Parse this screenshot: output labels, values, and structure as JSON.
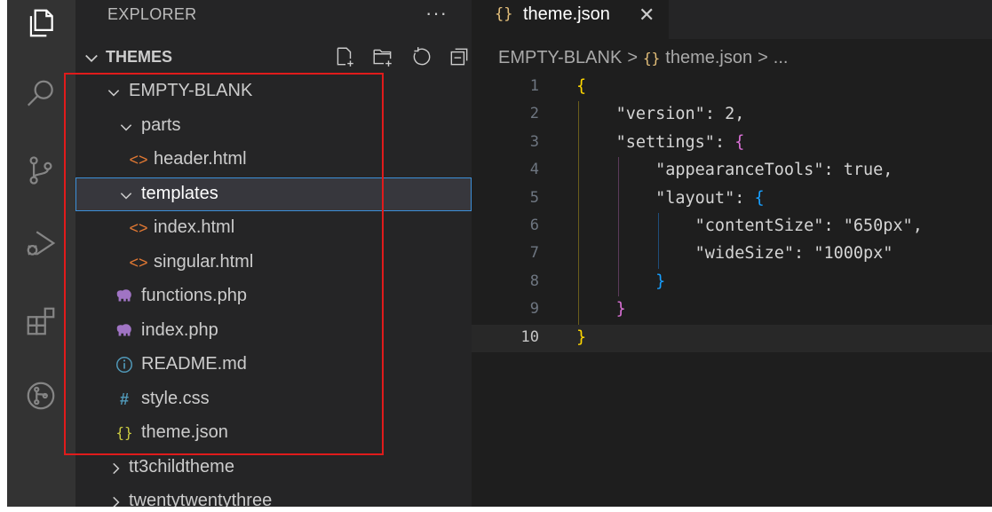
{
  "explorer": {
    "title": "EXPLORER",
    "more_label": "···",
    "section_title": "THEMES",
    "actions": [
      "new-file-icon",
      "new-folder-icon",
      "refresh-icon",
      "collapse-all-icon"
    ]
  },
  "tree": [
    {
      "label": "EMPTY-BLANK",
      "type": "folder",
      "expanded": true,
      "depth": 0
    },
    {
      "label": "parts",
      "type": "folder",
      "expanded": true,
      "depth": 1
    },
    {
      "label": "header.html",
      "type": "html",
      "depth": 2
    },
    {
      "label": "templates",
      "type": "folder",
      "expanded": true,
      "depth": 1,
      "selected": true
    },
    {
      "label": "index.html",
      "type": "html",
      "depth": 2
    },
    {
      "label": "singular.html",
      "type": "html",
      "depth": 2
    },
    {
      "label": "functions.php",
      "type": "php",
      "depth": 1
    },
    {
      "label": "index.php",
      "type": "php",
      "depth": 1
    },
    {
      "label": "README.md",
      "type": "info",
      "depth": 1
    },
    {
      "label": "style.css",
      "type": "css",
      "depth": 1
    },
    {
      "label": "theme.json",
      "type": "json",
      "depth": 1
    },
    {
      "label": "tt3childtheme",
      "type": "folder",
      "expanded": false,
      "depth": 0
    },
    {
      "label": "twentytwentythree",
      "type": "folder",
      "expanded": false,
      "depth": 0
    }
  ],
  "tab": {
    "icon": "{}",
    "label": "theme.json",
    "close": "✕"
  },
  "breadcrumb": {
    "folder": "EMPTY-BLANK",
    "sep": ">",
    "file_icon": "{}",
    "file": "theme.json",
    "more": "..."
  },
  "editor": {
    "active_line": 10,
    "lines": [
      {
        "n": "1",
        "text": "{"
      },
      {
        "n": "2",
        "text": "    \"version\": 2,"
      },
      {
        "n": "3",
        "text": "    \"settings\": {"
      },
      {
        "n": "4",
        "text": "        \"appearanceTools\": true,"
      },
      {
        "n": "5",
        "text": "        \"layout\": {"
      },
      {
        "n": "6",
        "text": "            \"contentSize\": \"650px\","
      },
      {
        "n": "7",
        "text": "            \"wideSize\": \"1000px\""
      },
      {
        "n": "8",
        "text": "        }"
      },
      {
        "n": "9",
        "text": "    }"
      },
      {
        "n": "10",
        "text": "}"
      }
    ]
  },
  "colors": {
    "highlight_box": "#e01b1b",
    "selection_outline": "#3c8fd8",
    "html_icon": "#e37933",
    "php_icon": "#a074c4",
    "info_icon": "#519aba",
    "css_icon": "#519aba",
    "json_icon": "#cbcb41"
  }
}
